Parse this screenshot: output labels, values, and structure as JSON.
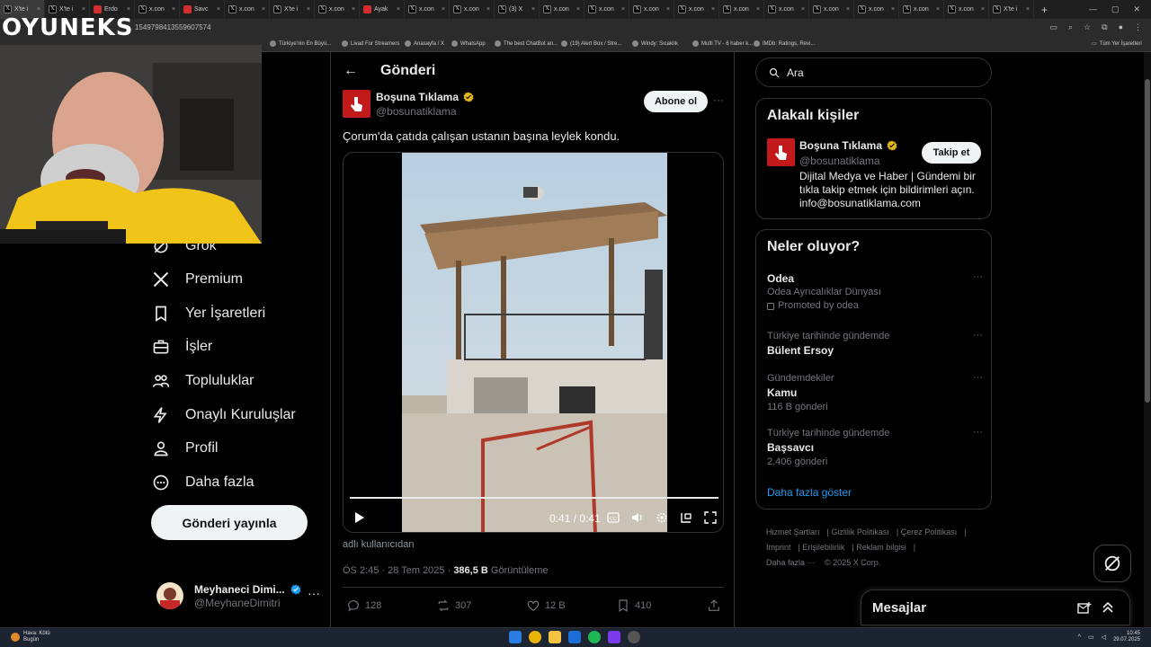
{
  "browser": {
    "tabs": [
      {
        "label": "X'te i",
        "fav": "x",
        "active": true
      },
      {
        "label": "X'te i",
        "fav": "x"
      },
      {
        "label": "Erdo",
        "fav": "red"
      },
      {
        "label": "x.con",
        "fav": "x"
      },
      {
        "label": "Savc",
        "fav": "red"
      },
      {
        "label": "x.con",
        "fav": "x"
      },
      {
        "label": "X'te i",
        "fav": "x"
      },
      {
        "label": "x.con",
        "fav": "x"
      },
      {
        "label": "Ayak",
        "fav": "red"
      },
      {
        "label": "x.con",
        "fav": "x"
      },
      {
        "label": "x.con",
        "fav": "x"
      },
      {
        "label": "(3) X",
        "fav": "x"
      },
      {
        "label": "x.con",
        "fav": "x"
      },
      {
        "label": "x.con",
        "fav": "x"
      },
      {
        "label": "x.con",
        "fav": "x"
      },
      {
        "label": "x.con",
        "fav": "x"
      },
      {
        "label": "x.con",
        "fav": "x"
      },
      {
        "label": "x.con",
        "fav": "x"
      },
      {
        "label": "x.con",
        "fav": "x"
      },
      {
        "label": "x.con",
        "fav": "x"
      },
      {
        "label": "x.con",
        "fav": "x"
      },
      {
        "label": "x.con",
        "fav": "x"
      },
      {
        "label": "X'te i",
        "fav": "x"
      }
    ],
    "url_fragment": "1549798413559607574",
    "bookmarks": [
      {
        "label": "Türkiye'nin En Büyü..."
      },
      {
        "label": "Livad For Streamers"
      },
      {
        "label": "Anasayfa / X"
      },
      {
        "label": "WhatsApp"
      },
      {
        "label": "The best ChatBot an..."
      },
      {
        "label": "(19) Alert Box / Stre..."
      },
      {
        "label": "Windy: Sıcaklık"
      },
      {
        "label": "Multi TV - 6 haber k..."
      },
      {
        "label": "IMDb: Ratings, Revi..."
      }
    ],
    "bookmarks_folder": "Tüm Yer İşaretleri"
  },
  "overlay": {
    "logo_text": "OYUNEKS"
  },
  "nav": {
    "items": [
      {
        "label": "Grok",
        "icon": "grok-icon"
      },
      {
        "label": "Premium",
        "icon": "x-logo-icon"
      },
      {
        "label": "Yer İşaretleri",
        "icon": "bookmark-icon"
      },
      {
        "label": "İşler",
        "icon": "briefcase-icon"
      },
      {
        "label": "Topluluklar",
        "icon": "communities-icon"
      },
      {
        "label": "Onaylı Kuruluşlar",
        "icon": "lightning-icon"
      },
      {
        "label": "Profil",
        "icon": "profile-icon"
      },
      {
        "label": "Daha fazla",
        "icon": "more-circle-icon"
      }
    ],
    "post_button": "Gönderi yayınla",
    "account": {
      "name": "Meyhaneci Dimi...",
      "handle": "@MeyhaneDimitri"
    }
  },
  "main": {
    "title": "Gönderi",
    "post": {
      "author_name": "Boşuna Tıklama",
      "author_handle": "@bosunatiklama",
      "follow_label": "Abone ol",
      "text": "Çorum'da çatıda çalışan ustanın başına leylek kondu.",
      "video": {
        "time": "0:41 / 0:41",
        "progress": 1.0
      },
      "source_credit": "adlı kullanıcıdan",
      "timestamp": "ÖS 2:45 · 28 Tem 2025 · ",
      "views": "386,5 B",
      "views_label": " Görüntüleme",
      "actions": {
        "replies": "128",
        "reposts": "307",
        "likes": "12 B",
        "bookmarks": "410"
      }
    }
  },
  "right": {
    "search_placeholder": "Ara",
    "relevant": {
      "title": "Alakalı kişiler",
      "name": "Boşuna Tıklama",
      "handle": "@bosunatiklama",
      "follow_label": "Takip et",
      "bio": "Dijital Medya ve Haber | Gündemi bir tıkla takip etmek için bildirimleri açın. info@bosunatiklama.com"
    },
    "trends": {
      "title": "Neler oluyor?",
      "items": [
        {
          "context": "",
          "name": "Odea",
          "count": "",
          "sub": "Odea Ayrıcalıklar Dünyası",
          "promoted": "Promoted by odea"
        },
        {
          "context": "Türkiye tarihinde gündemde",
          "name": "Bülent Ersoy",
          "count": ""
        },
        {
          "context": "Gündemdekiler",
          "name": "Kamu",
          "count": "116 B gönderi"
        },
        {
          "context": "Türkiye tarihinde gündemde",
          "name": "Başsavcı",
          "count": "2.406 gönderi"
        }
      ],
      "show_more": "Daha fazla göster"
    },
    "footer": {
      "links": [
        "Hizmet Şartları",
        "Gizlilik Politikası",
        "Çerez Politikası",
        "Imprint",
        "Erişilebilirlik",
        "Reklam bilgisi",
        "Daha fazla ···",
        "© 2025 X Corp."
      ]
    },
    "messages_title": "Mesajlar"
  },
  "taskbar": {
    "weather_line1": "Hava: Kötü",
    "weather_line2": "Bugün",
    "time": "10:45",
    "date": "29.07.2025"
  },
  "colors": {
    "accent": "#1d9bf0",
    "verified_gold": "#e2b719",
    "verified_blue": "#1d9bf0",
    "brand_red": "#c21a1a"
  }
}
